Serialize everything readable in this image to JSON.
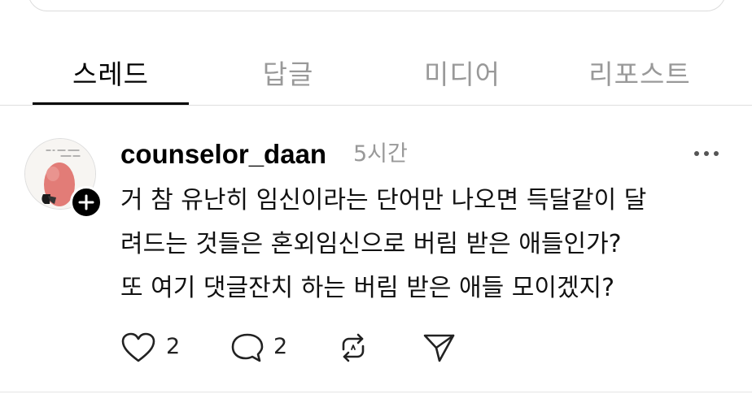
{
  "tabs": [
    {
      "label": "스레드",
      "active": true
    },
    {
      "label": "답글",
      "active": false
    },
    {
      "label": "미디어",
      "active": false
    },
    {
      "label": "리포스트",
      "active": false
    }
  ],
  "post": {
    "username": "counselor_daan",
    "time": "5시간",
    "lines": [
      "거 참 유난히 임신이라는 단어만 나오면 득달같이 달",
      "려드는 것들은 혼외임신으로 버림 받은 애들인가?",
      "또 여기 댓글잔치 하는 버림 받은 애들 모이겠지?"
    ],
    "likes": "2",
    "comments": "2"
  },
  "icons": {
    "more": "more-horizontal-icon",
    "follow": "plus-icon",
    "like": "heart-icon",
    "comment": "comment-bubble-icon",
    "repost": "repost-icon",
    "share": "send-icon"
  }
}
